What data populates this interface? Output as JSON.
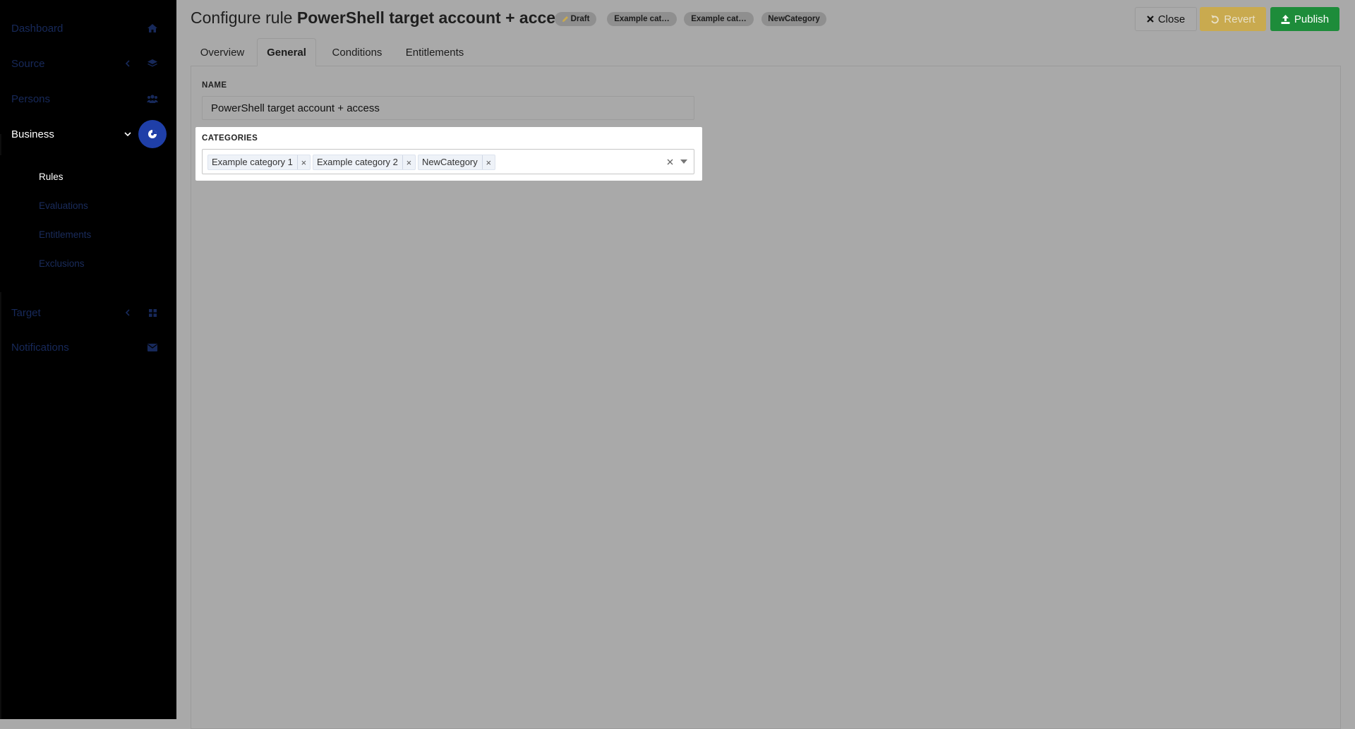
{
  "sidebar": {
    "items": [
      {
        "label": "Dashboard",
        "icon": "home-icon"
      },
      {
        "label": "Source",
        "icon": "layers-icon"
      },
      {
        "label": "Persons",
        "icon": "users-icon"
      },
      {
        "label": "Business",
        "icon": "business-icon"
      },
      {
        "label": "Target",
        "icon": "grid-icon"
      },
      {
        "label": "Notifications",
        "icon": "envelope-icon"
      }
    ],
    "business_subitems": [
      "Rules",
      "Evaluations",
      "Entitlements",
      "Exclusions"
    ],
    "active_item": "Business",
    "active_subitem": "Rules"
  },
  "header": {
    "title_prefix": "Configure rule",
    "title_name": "PowerShell target account + access",
    "badges": [
      "Draft",
      "Example cat…",
      "Example cat…",
      "NewCategory"
    ],
    "buttons": {
      "close": "Close",
      "revert": "Revert",
      "publish": "Publish"
    }
  },
  "tabs": [
    "Overview",
    "General",
    "Conditions",
    "Entitlements"
  ],
  "active_tab": "General",
  "form": {
    "name_label": "NAME",
    "name_value": "PowerShell target account + access",
    "categories_label": "CATEGORIES",
    "categories": [
      "Example category 1",
      "Example category 2",
      "NewCategory"
    ],
    "chip_remove_glyph": "×"
  },
  "colors": {
    "sidebar_bg": "#000000",
    "active_icon_bg": "#1f3fa8",
    "revert": "#c9aa4f",
    "publish": "#1d8c3a",
    "overlay": "#a9a9a9"
  }
}
